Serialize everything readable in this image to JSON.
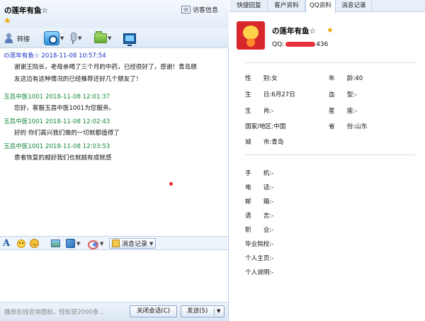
{
  "left_header": {
    "title": "の莲年有鱼☆",
    "visitor_info_label": "访客信息"
  },
  "toolbar": {
    "transfer_label": "转接"
  },
  "messages": [
    {
      "sender": "の莲年有鱼☆",
      "time": "2018-11-08 10:57:54",
      "role": "customer",
      "lines": [
        "谢谢王院长，老母亲喝了三个月的中药，已经很好了，感谢！青岛朋",
        "友这边有这种情况的已经推荐还好几个朋友了！"
      ]
    },
    {
      "sender": "玉昌中医1001",
      "time": "2018-11-08 12:01:37",
      "role": "agent",
      "lines": [
        "您好，客服玉昌中医1001为您服务。"
      ]
    },
    {
      "sender": "玉昌中医1001",
      "time": "2018-11-08 12:02:43",
      "role": "agent",
      "lines": [
        "好的  你们高兴我们做的一切就都值得了"
      ]
    },
    {
      "sender": "玉昌中医1001",
      "time": "2018-11-08 12:03:53",
      "role": "agent",
      "lines": [
        "患者恢复的越好我们也就越有成就感"
      ]
    }
  ],
  "format_bar": {
    "font_glyph": "A",
    "history_label": "消息记录"
  },
  "send_bar": {
    "promo_text": "播放在线咨询图标，轻松获2000条...",
    "close_session_label": "关闭会话(C)",
    "send_label": "发送(S)"
  },
  "right_tabs": [
    "快捷回复",
    "客户资料",
    "QQ资料",
    "消息记录"
  ],
  "active_tab": "QQ资料",
  "profile": {
    "nickname": "の莲年有鱼☆",
    "qq_prefix": "QQ:",
    "qq_suffix": "436",
    "gender_label": "性　　别:",
    "gender": "女",
    "age_label": "年　　龄:",
    "age": "40",
    "birthday_label": "生　　日:",
    "birthday": "6月27日",
    "blood_label": "血　　型:",
    "blood": "-",
    "zodiac_label": "生　　肖:",
    "zodiac": "-",
    "constellation_label": "星　　座:",
    "constellation": "-",
    "country_label": "国家/地区:",
    "country": "中国",
    "province_label": "省　　份:",
    "province": "山东",
    "city_label": "城　　市:",
    "city": "青岛",
    "mobile_label": "手　　机:",
    "mobile": "-",
    "phone_label": "电　　话:",
    "phone": "-",
    "email_label": "邮　　箱:",
    "email": "-",
    "language_label": "语　　言:",
    "language": "-",
    "job_label": "职　　业:",
    "job": "-",
    "school_label": "毕业院校:",
    "school": "-",
    "homepage_label": "个人主页:",
    "homepage": "-",
    "bio_label": "个人说明:",
    "bio": "-"
  },
  "colors": {
    "customer_name": "#1a33c8",
    "agent_name": "#168a3c",
    "star": "#f0a800",
    "pane_border": "#b7cce4"
  }
}
